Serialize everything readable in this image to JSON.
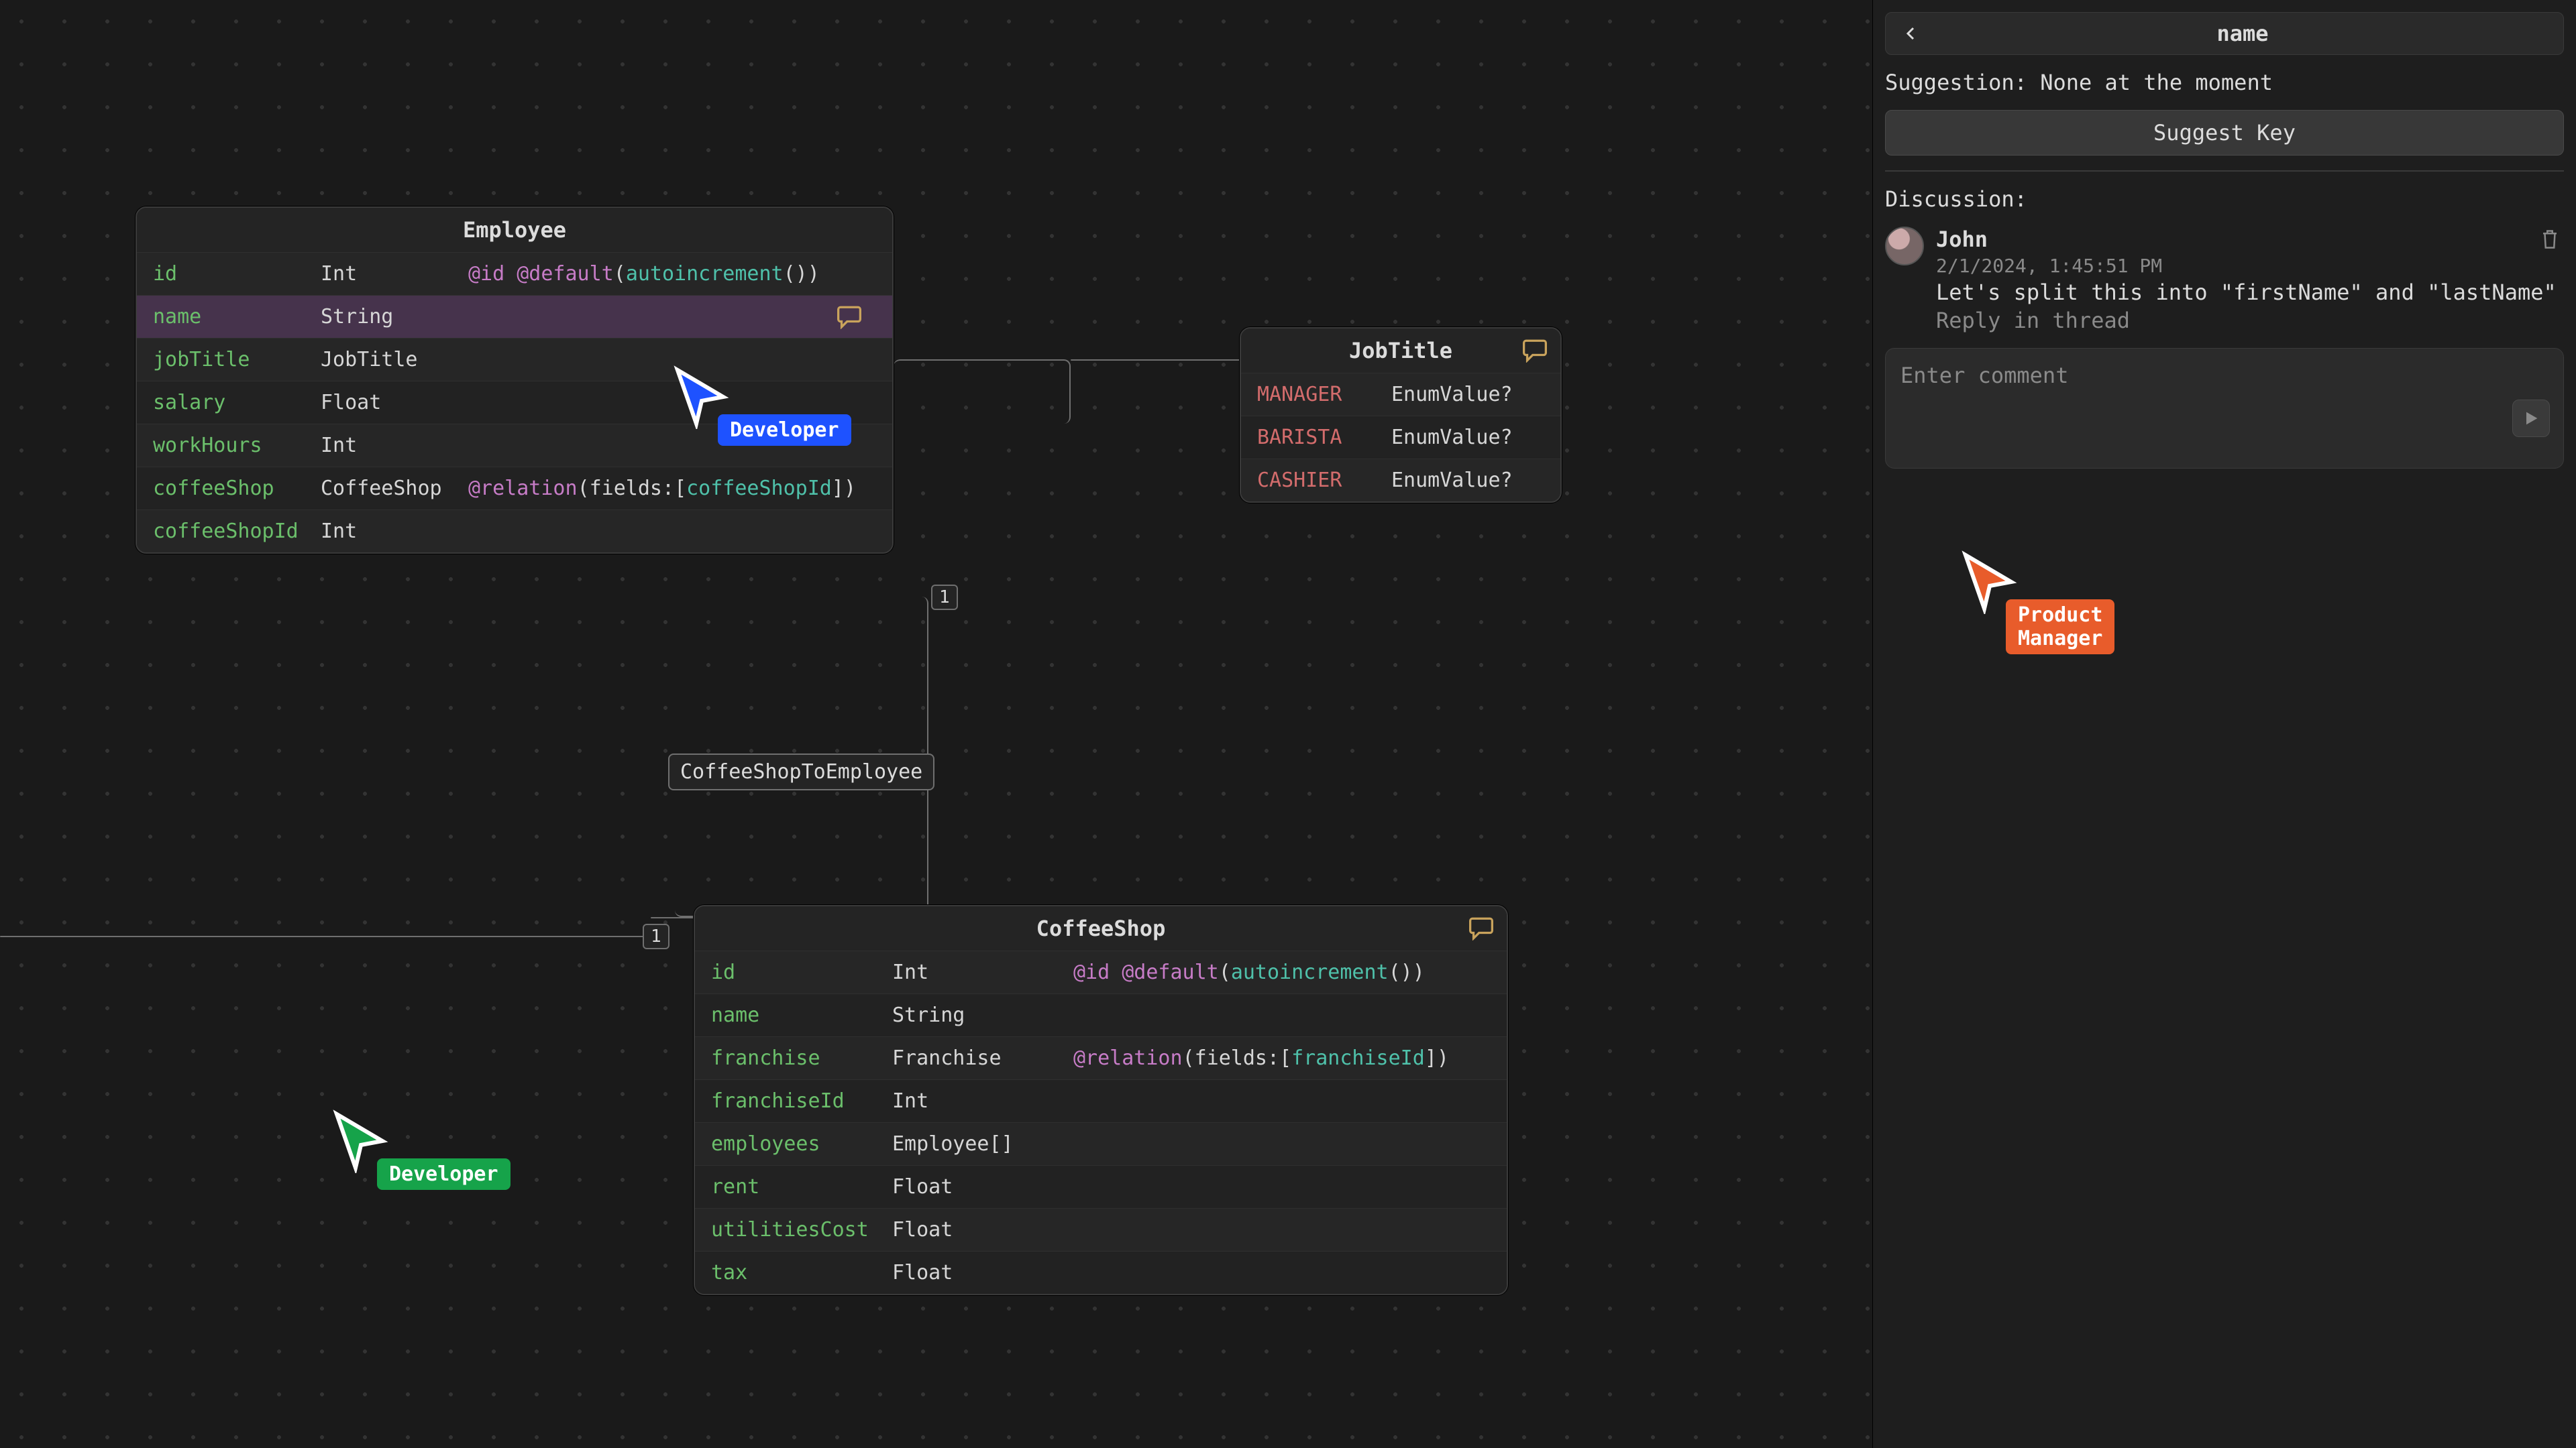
{
  "cursors": {
    "blue": {
      "label": "Developer"
    },
    "green": {
      "label": "Developer"
    },
    "orange": {
      "label": "Product Manager"
    }
  },
  "relations": {
    "coffeeShopEmployee": {
      "label": "CoffeeShopToEmployee",
      "left_card": "1",
      "right_card": "1"
    }
  },
  "tables": {
    "employee": {
      "title": "Employee",
      "rows": {
        "id": {
          "field": "id",
          "type": "Int",
          "at1": "@id",
          "at2": "@default",
          "fn": "autoincrement",
          "par_open": "(",
          "par_close": "()",
          "tail": ")"
        },
        "name": {
          "field": "name",
          "type": "String"
        },
        "jobTitle": {
          "field": "jobTitle",
          "type": "JobTitle"
        },
        "salary": {
          "field": "salary",
          "type": "Float"
        },
        "workHours": {
          "field": "workHours",
          "type": "Int"
        },
        "coffeeShop": {
          "field": "coffeeShop",
          "type": "CoffeeShop",
          "rel": "@relation",
          "flds_kw": "fields",
          "colon": ":",
          "lb": "[",
          "ref": "coffeeShopId",
          "rb": "]",
          "po": "(",
          "pc": ")"
        },
        "coffeeShopId": {
          "field": "coffeeShopId",
          "type": "Int"
        }
      }
    },
    "jobTitle": {
      "title": "JobTitle",
      "rows": {
        "manager": {
          "field": "MANAGER",
          "type": "EnumValue?"
        },
        "barista": {
          "field": "BARISTA",
          "type": "EnumValue?"
        },
        "cashier": {
          "field": "CASHIER",
          "type": "EnumValue?"
        }
      }
    },
    "coffeeShop": {
      "title": "CoffeeShop",
      "rows": {
        "id": {
          "field": "id",
          "type": "Int",
          "at1": "@id",
          "at2": "@default",
          "fn": "autoincrement",
          "po": "(",
          "pc": "()",
          "tail": ")"
        },
        "name": {
          "field": "name",
          "type": "String"
        },
        "franchise": {
          "field": "franchise",
          "type": "Franchise",
          "rel": "@relation",
          "flds_kw": "fields",
          "colon": ":",
          "lb": "[",
          "ref": "franchiseId",
          "rb": "]",
          "po": "(",
          "pc": ")"
        },
        "franchiseId": {
          "field": "franchiseId",
          "type": "Int"
        },
        "employees": {
          "field": "employees",
          "type": "Employee",
          "arr": "[]"
        },
        "rent": {
          "field": "rent",
          "type": "Float"
        },
        "utilitiesCost": {
          "field": "utilitiesCost",
          "type": "Float"
        },
        "tax": {
          "field": "tax",
          "type": "Float"
        }
      }
    }
  },
  "sidebar": {
    "title": "name",
    "suggestion_prefix": "Suggestion: ",
    "suggestion_value": "None at the moment",
    "suggest_btn": "Suggest Key",
    "discussion_label": "Discussion:",
    "comment_placeholder": "Enter comment",
    "comments": [
      {
        "author": "John",
        "time": "2/1/2024, 1:45:51 PM",
        "text": "Let's split this into \"firstName\" and \"lastName\"",
        "reply": "Reply in thread"
      }
    ]
  }
}
